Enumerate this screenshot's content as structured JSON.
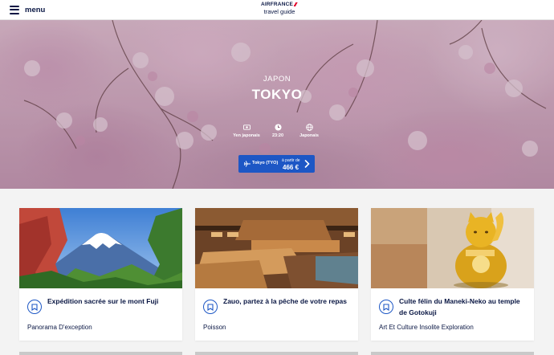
{
  "header": {
    "menu_label": "menu",
    "logo_brand": "AIRFRANCE",
    "logo_sub": "travel guide"
  },
  "hero": {
    "country": "JAPON",
    "city": "TOKYO",
    "facts": [
      {
        "icon": "banknote-icon",
        "label": "Yen japonais"
      },
      {
        "icon": "clock-icon",
        "label": "23:20"
      },
      {
        "icon": "globe-icon",
        "label": "Japonais"
      }
    ],
    "cta": {
      "destination": "Tokyo (TYO)",
      "from_label": "à partir de",
      "price": "466 €",
      "icons": [
        "plane-icon",
        "chevron-right-icon"
      ],
      "color": "#1d57c5"
    }
  },
  "cards": [
    {
      "title": "Expédition sacrée sur le mont Fuji",
      "tag": "Panorama D'exception",
      "image": "mount-fuji-photo"
    },
    {
      "title": "Zauo, partez à la pêche de votre repas",
      "tag": "Poisson",
      "image": "restaurant-photo"
    },
    {
      "title": "Culte félin du Maneki-Neko au temple de Gotokuji",
      "tag": "Art Et Culture Insolite Exploration",
      "image": "maneki-neko-photo"
    }
  ],
  "colors": {
    "navy": "#0a1744",
    "accent_blue": "#1d57c5",
    "brand_red": "#e4002b"
  }
}
